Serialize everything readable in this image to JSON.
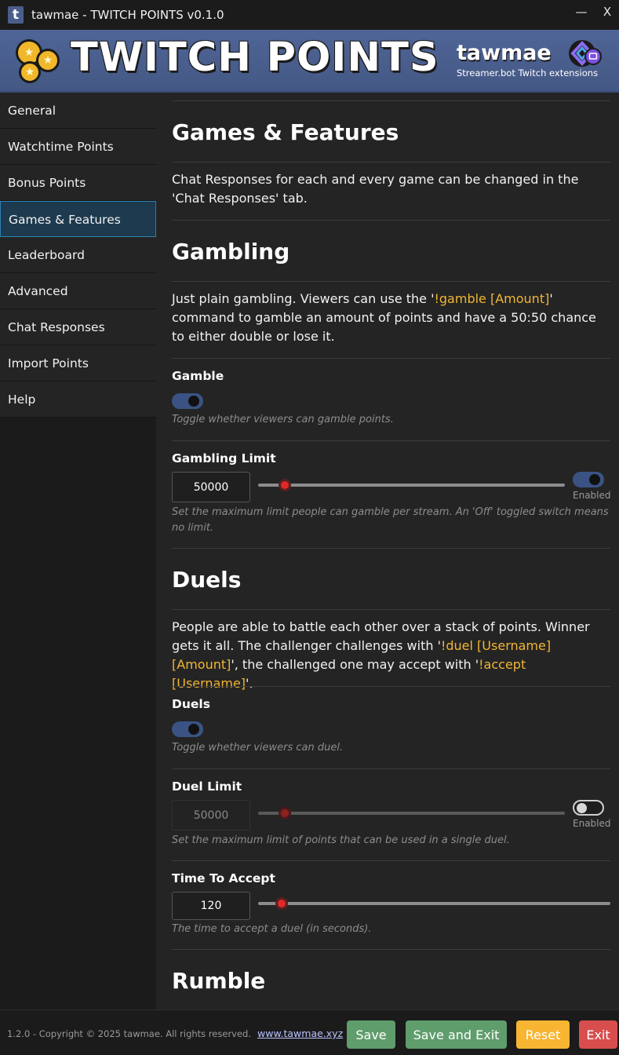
{
  "window": {
    "icon_letter": "t",
    "title": "tawmae - TWITCH POINTS v0.1.0",
    "minimize": "—",
    "close": "X"
  },
  "banner": {
    "title": "TWITCH POINTS",
    "brand": "tawmae",
    "brand_sub": "Streamer.bot Twitch extensions"
  },
  "sidebar": {
    "items": [
      {
        "label": "General"
      },
      {
        "label": "Watchtime Points"
      },
      {
        "label": "Bonus Points"
      },
      {
        "label": "Games & Features",
        "active": true
      },
      {
        "label": "Leaderboard"
      },
      {
        "label": "Advanced"
      },
      {
        "label": "Chat Responses"
      },
      {
        "label": "Import Points"
      },
      {
        "label": "Help"
      }
    ]
  },
  "content": {
    "page_title": "Games & Features",
    "intro": "Chat Responses for each and every game can be changed in the 'Chat Responses' tab.",
    "gambling": {
      "heading": "Gambling",
      "desc_pre": "Just plain gambling. Viewers can use the '",
      "desc_cmd": "!gamble [Amount]",
      "desc_post": "' command to gamble an amount of points and have a 50:50 chance to either double or lose it.",
      "toggle_title": "Gamble",
      "toggle_on": true,
      "toggle_hint": "Toggle whether viewers can gamble points.",
      "limit_title": "Gambling Limit",
      "limit_value": "50000",
      "limit_slider_fraction": 0.07,
      "limit_enabled": true,
      "limit_toggle_label": "Enabled",
      "limit_hint": "Set the maximum limit people can gamble per stream. An 'Off' toggled switch means no limit."
    },
    "duels": {
      "heading": "Duels",
      "desc_1": "People are able to battle each other over a stack of points. Winner gets it all. The challenger challenges with '",
      "desc_cmd1a": "!duel [Username]",
      "desc_cmd1b": "[Amount]",
      "desc_2": "', the challenged one may accept with '",
      "desc_cmd2": "!accept [Username]",
      "desc_3": "'.",
      "toggle_title": "Duels",
      "toggle_on": true,
      "toggle_hint": "Toggle whether viewers can duel.",
      "limit_title": "Duel Limit",
      "limit_value": "50000",
      "limit_slider_fraction": 0.07,
      "limit_enabled": false,
      "limit_toggle_label": "Enabled",
      "limit_hint": "Set the maximum limit of points that can be used in a single duel.",
      "accept_title": "Time To Accept",
      "accept_value": "120",
      "accept_slider_fraction": 0.05,
      "accept_hint": "The time to accept a duel (in seconds)."
    },
    "rumble": {
      "heading": "Rumble"
    }
  },
  "footer": {
    "copyright": "1.2.0 - Copyright © 2025 tawmae. All rights reserved.",
    "link": "www.tawmae.xyz",
    "save": "Save",
    "save_exit": "Save and Exit",
    "reset": "Reset",
    "exit": "Exit"
  },
  "colors": {
    "accent_blue": "#3a5384",
    "highlight_yellow": "#f2b632",
    "save_green": "#5f9d6c",
    "reset_orange": "#f7b531",
    "exit_red": "#d84e4e",
    "slider_red": "#e02828"
  }
}
